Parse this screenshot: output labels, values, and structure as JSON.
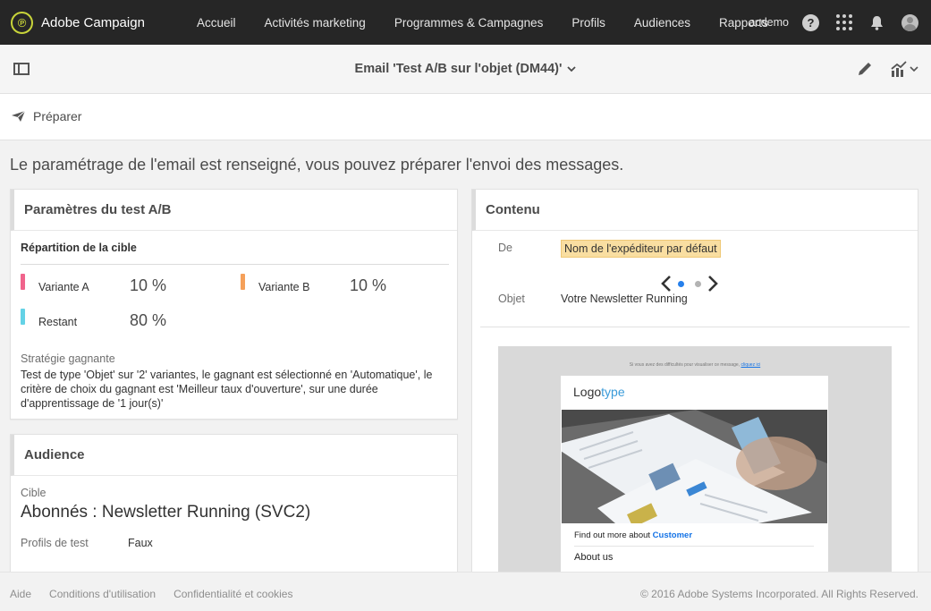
{
  "app": {
    "name": "Adobe Campaign"
  },
  "nav": {
    "items": [
      "Accueil",
      "Activités marketing",
      "Programmes & Campagnes",
      "Profils",
      "Audiences",
      "Rapports"
    ],
    "user": "acdemo"
  },
  "titlebar": {
    "title": "Email 'Test A/B sur l'objet (DM44)'"
  },
  "actionbar": {
    "prepare_label": "Préparer"
  },
  "status_message": "Le paramétrage de l'email est renseigné, vous pouvez préparer l'envoi des messages.",
  "ab_test": {
    "title": "Paramètres du test A/B",
    "distribution_title": "Répartition de la cible",
    "variants": [
      {
        "label": "Variante A",
        "percent": "10 %",
        "color": "#f0648c"
      },
      {
        "label": "Variante B",
        "percent": "10 %",
        "color": "#f5a05a"
      },
      {
        "label": "Restant",
        "percent": "80 %",
        "color": "#64d2e6"
      }
    ],
    "strategy_label": "Stratégie gagnante",
    "strategy_text": "Test de type 'Objet' sur '2' variantes, le gagnant est sélectionné en 'Automatique', le critère de choix du gagnant est 'Meilleur taux d'ouverture', sur une durée d'apprentissage de '1 jour(s)'"
  },
  "audience": {
    "title": "Audience",
    "target_label": "Cible",
    "target_value": "Abonnés : Newsletter Running (SVC2)",
    "test_profiles_label": "Profils de test",
    "test_profiles_value": "Faux"
  },
  "content": {
    "title": "Contenu",
    "from_label": "De",
    "from_value": "Nom de l'expéditeur par défaut",
    "subject_label": "Objet",
    "subject_value": "Votre Newsletter Running",
    "pager": {
      "active_index": 0,
      "total": 2,
      "active_color": "#2680eb",
      "inactive_color": "#b3b3b3"
    },
    "preview": {
      "top_text": "Si vous avez des difficultés pour visualiser ce message,",
      "top_link": "cliquez ici",
      "logo_a": "Logo",
      "logo_b": "type",
      "find_text": "Find out more about",
      "find_link": "Customer",
      "about": "About us"
    }
  },
  "footer": {
    "links": [
      "Aide",
      "Conditions d'utilisation",
      "Confidentialité et cookies"
    ],
    "copyright": "© 2016 Adobe Systems Incorporated. All Rights Reserved."
  }
}
